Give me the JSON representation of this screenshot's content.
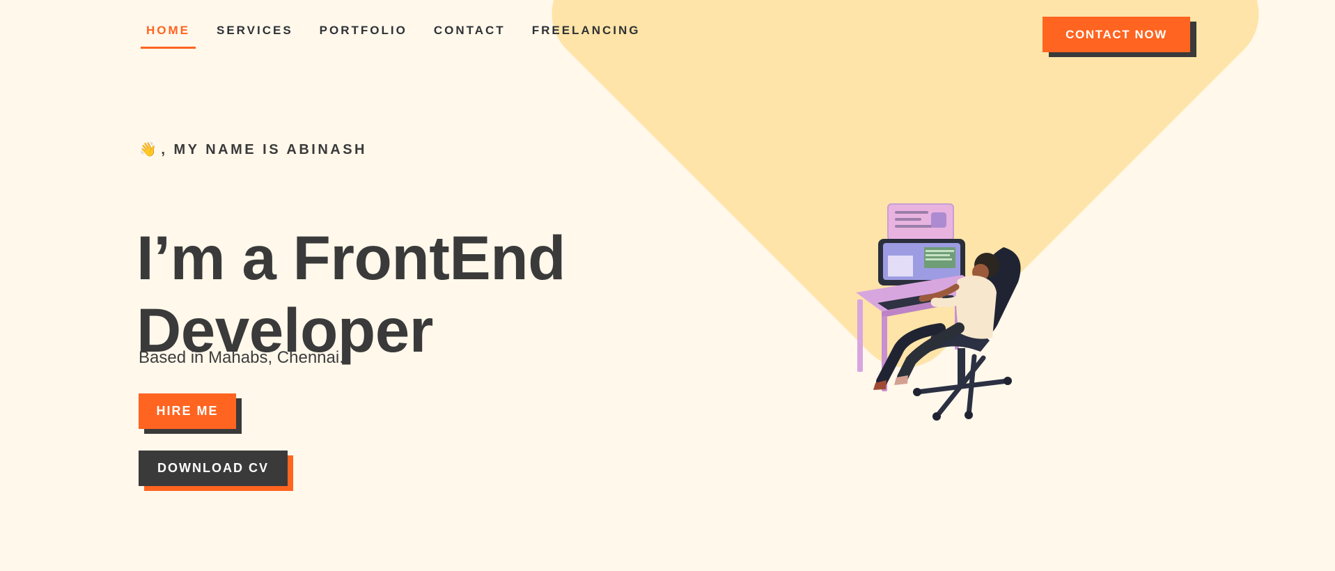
{
  "header": {
    "nav": [
      {
        "label": "HOME",
        "active": true
      },
      {
        "label": "SERVICES",
        "active": false
      },
      {
        "label": "PORTFOLIO",
        "active": false
      },
      {
        "label": "CONTACT",
        "active": false
      },
      {
        "label": "FREELANCING",
        "active": false
      }
    ],
    "contact_button": "CONTACT NOW"
  },
  "hero": {
    "intro_icon": "waving-hand-icon",
    "intro_text": ", MY NAME IS ABINASH",
    "headline_line1": "I’m a FrontEnd",
    "headline_line2": "Developer",
    "location": "Based in Mahabs, Chennai.",
    "hire_button": "HIRE ME",
    "download_button": "DOWNLOAD CV",
    "illustration": "developer-at-desk-illustration"
  },
  "colors": {
    "background": "#fff8eb",
    "accent": "#ff6420",
    "shape": "#fee4a8",
    "dark": "#3a3a3a"
  }
}
